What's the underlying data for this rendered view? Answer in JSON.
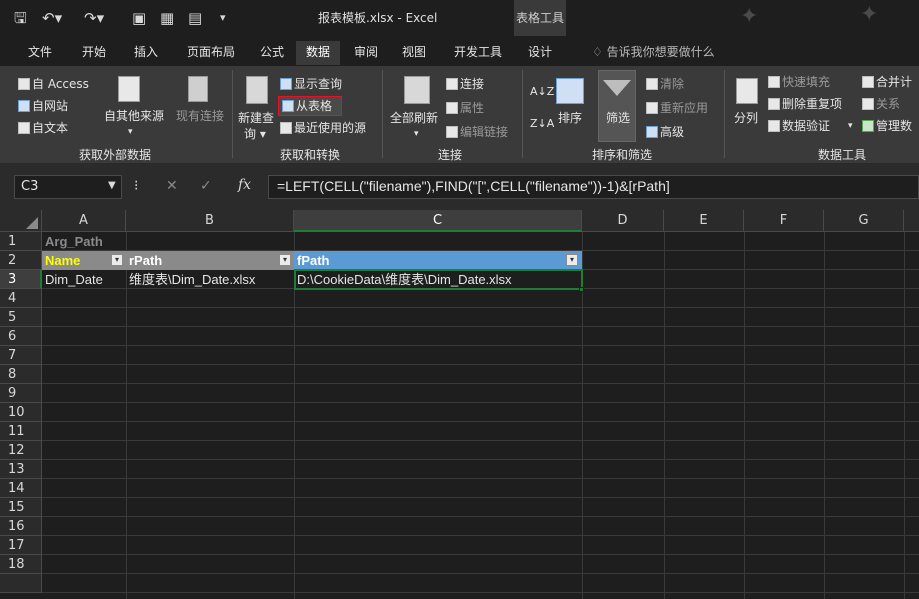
{
  "window": {
    "title": "报表模板.xlsx  -  Excel",
    "context_tab_header": "表格工具"
  },
  "tabs": [
    {
      "label": "文件"
    },
    {
      "label": "开始"
    },
    {
      "label": "插入"
    },
    {
      "label": "页面布局"
    },
    {
      "label": "公式"
    },
    {
      "label": "数据"
    },
    {
      "label": "审阅"
    },
    {
      "label": "视图"
    },
    {
      "label": "开发工具"
    },
    {
      "label": "设计"
    }
  ],
  "tell_me": "告诉我你想要做什么",
  "ribbon": {
    "get_external": {
      "label": "获取外部数据",
      "access": "自 Access",
      "web": "自网站",
      "text": "自文本",
      "other": "自其他来源",
      "existing": "现有连接"
    },
    "get_transform": {
      "label": "获取和转换",
      "new_query_1": "新建查",
      "new_query_2": "询 ▾",
      "show_queries": "显示查询",
      "from_table": "从表格",
      "recent_sources": "最近使用的源"
    },
    "connections": {
      "label": "连接",
      "refresh_all": "全部刷新",
      "refresh_arrow": "▾",
      "connections": "连接",
      "properties": "属性",
      "edit_links": "编辑链接"
    },
    "sort_filter": {
      "label": "排序和筛选",
      "sort": "排序",
      "filter": "筛选",
      "clear": "清除",
      "reapply": "重新应用",
      "advanced": "高级"
    },
    "data_tools": {
      "label": "数据工具",
      "text_to_columns": "分列",
      "flash_fill": "快速填充",
      "remove_duplicates": "删除重复项",
      "data_validation": "数据验证",
      "validation_arrow": "▾",
      "consolidate": "合并计",
      "relationships": "关系",
      "manage_model": "管理数"
    }
  },
  "formula_bar": {
    "name_box": "C3",
    "formula": "=LEFT(CELL(\"filename\"),FIND(\"[\",CELL(\"filename\"))-1)&[rPath]"
  },
  "grid": {
    "columns": [
      "A",
      "B",
      "C",
      "D",
      "E",
      "F",
      "G"
    ],
    "rows": [
      "1",
      "2",
      "3",
      "4",
      "5",
      "6",
      "7",
      "8",
      "9",
      "10",
      "11",
      "12",
      "13",
      "14",
      "15",
      "16",
      "17",
      "18"
    ],
    "cells": {
      "A1": "Arg_Path",
      "A2": "Name",
      "B2": "rPath",
      "C2": "fPath",
      "A3": "Dim_Date",
      "B3": "维度表\\Dim_Date.xlsx",
      "C3": "D:\\CookieData\\维度表\\Dim_Date.xlsx"
    }
  },
  "colors": {
    "accent_green": "#1f7d3a",
    "header_gray": "#8a8a8a",
    "header_blue": "#5b9bd5",
    "name_yellow": "#ffff00",
    "highlight_red": "#e81123"
  }
}
